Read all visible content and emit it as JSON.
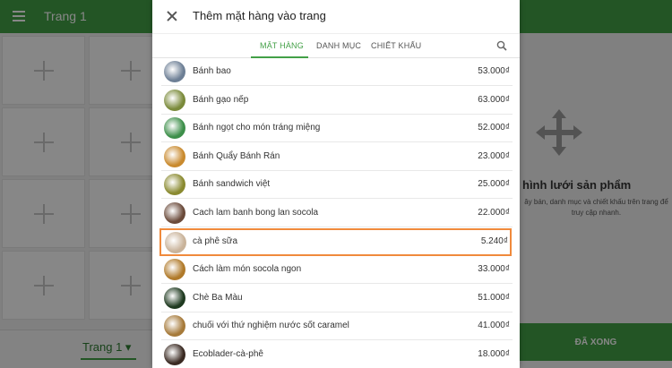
{
  "background": {
    "app_title": "Trang 1",
    "page_selector": "Trang 1 ▾",
    "hint_title": "hình lưới sản phẩm",
    "hint_desc": "ây bán, danh mục và chiết khấu trên trang để truy cập nhanh.",
    "done_button": "ĐÃ XONG",
    "accent": "#43a047"
  },
  "dialog": {
    "title": "Thêm mặt hàng vào trang",
    "tabs": [
      {
        "label": "MẶT HÀNG",
        "active": true
      },
      {
        "label": "DANH MỤC",
        "active": false
      },
      {
        "label": "CHIẾT KHẤU",
        "active": false
      }
    ],
    "search_icon": "search-icon",
    "close_icon": "close-icon",
    "highlight_color": "#f08a3c",
    "items": [
      {
        "name": "Bánh bao",
        "price": "53.000₫",
        "thumb_color": "#6d7f95"
      },
      {
        "name": "Bánh gạo nếp",
        "price": "63.000₫",
        "thumb_color": "#7a8a3a"
      },
      {
        "name": "Bánh ngọt cho món tráng miệng",
        "price": "52.000₫",
        "thumb_color": "#3d8f4a"
      },
      {
        "name": "Bánh Quẩy Bánh Rán",
        "price": "23.000₫",
        "thumb_color": "#c98a2e"
      },
      {
        "name": "Bánh sandwich việt",
        "price": "25.000₫",
        "thumb_color": "#8a8a30"
      },
      {
        "name": "Cach lam banh bong lan socola",
        "price": "22.000₫",
        "thumb_color": "#6a4a3a"
      },
      {
        "name": "cà phê sữa",
        "price": "5.240₫",
        "thumb_color": "#c9b39a",
        "selected": true
      },
      {
        "name": "Cách làm món socola ngon",
        "price": "33.000₫",
        "thumb_color": "#b07a2a"
      },
      {
        "name": "Chè Ba Màu",
        "price": "51.000₫",
        "thumb_color": "#1f3a20"
      },
      {
        "name": "chuối với thứ nghiệm nước sốt caramel",
        "price": "41.000₫",
        "thumb_color": "#a67a3a"
      },
      {
        "name": "Ecoblader-cà-phê",
        "price": "18.000₫",
        "thumb_color": "#3a2a22"
      }
    ]
  }
}
